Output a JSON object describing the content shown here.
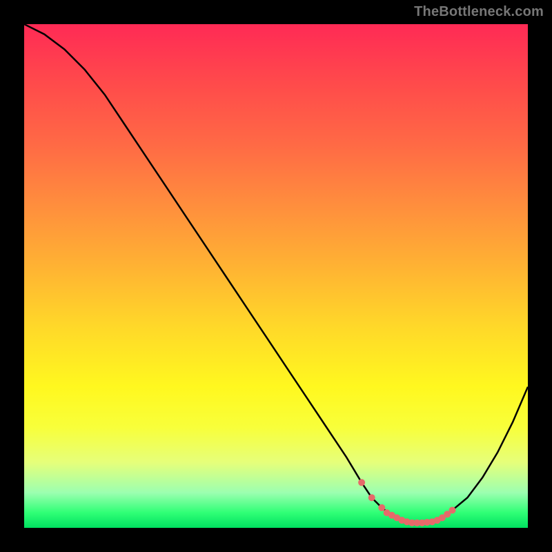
{
  "watermark": "TheBottleneck.com",
  "colors": {
    "background": "#000000",
    "curve": "#000000",
    "marker": "#e66a6a",
    "gradient_top": "#ff2a55",
    "gradient_bottom": "#00e060"
  },
  "chart_data": {
    "type": "line",
    "title": "",
    "xlabel": "",
    "ylabel": "",
    "xlim": [
      0,
      100
    ],
    "ylim": [
      0,
      100
    ],
    "grid": false,
    "series": [
      {
        "name": "bottleneck-curve",
        "x": [
          0,
          4,
          8,
          12,
          16,
          20,
          24,
          28,
          32,
          36,
          40,
          44,
          48,
          52,
          56,
          60,
          64,
          67,
          69,
          71,
          73,
          75,
          77,
          79,
          81,
          83,
          85,
          88,
          91,
          94,
          97,
          100
        ],
        "values": [
          100,
          98,
          95,
          91,
          86,
          80,
          74,
          68,
          62,
          56,
          50,
          44,
          38,
          32,
          26,
          20,
          14,
          9,
          6,
          4,
          2.5,
          1.5,
          1,
          1,
          1.2,
          2,
          3.5,
          6,
          10,
          15,
          21,
          28
        ]
      }
    ],
    "markers": {
      "name": "optimum-band",
      "x": [
        67,
        69,
        71,
        72,
        73,
        74,
        75,
        76,
        77,
        78,
        79,
        80,
        81,
        82,
        83,
        84,
        85
      ],
      "values": [
        9,
        6,
        4,
        3,
        2.5,
        2,
        1.5,
        1.2,
        1,
        1,
        1,
        1.1,
        1.2,
        1.5,
        2,
        2.7,
        3.5
      ]
    }
  }
}
